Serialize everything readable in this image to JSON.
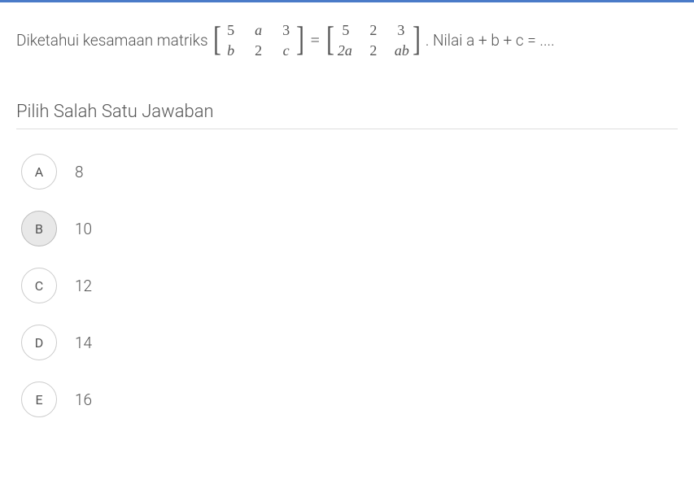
{
  "question": {
    "prefix": "Diketahui kesamaan matriks ",
    "suffix": ". Nilai a + b + c = ....",
    "matrix_left": {
      "r1": [
        "5",
        "a",
        "3"
      ],
      "r2": [
        "b",
        "2",
        "c"
      ]
    },
    "equals": "=",
    "matrix_right": {
      "r1": [
        "5",
        "2",
        "3"
      ],
      "r2": [
        "2a",
        "2",
        "ab"
      ]
    }
  },
  "section_title": "Pilih Salah Satu Jawaban",
  "answers": [
    {
      "letter": "A",
      "text": "8",
      "selected": false
    },
    {
      "letter": "B",
      "text": "10",
      "selected": true
    },
    {
      "letter": "C",
      "text": "12",
      "selected": false
    },
    {
      "letter": "D",
      "text": "14",
      "selected": false
    },
    {
      "letter": "E",
      "text": "16",
      "selected": false
    }
  ]
}
